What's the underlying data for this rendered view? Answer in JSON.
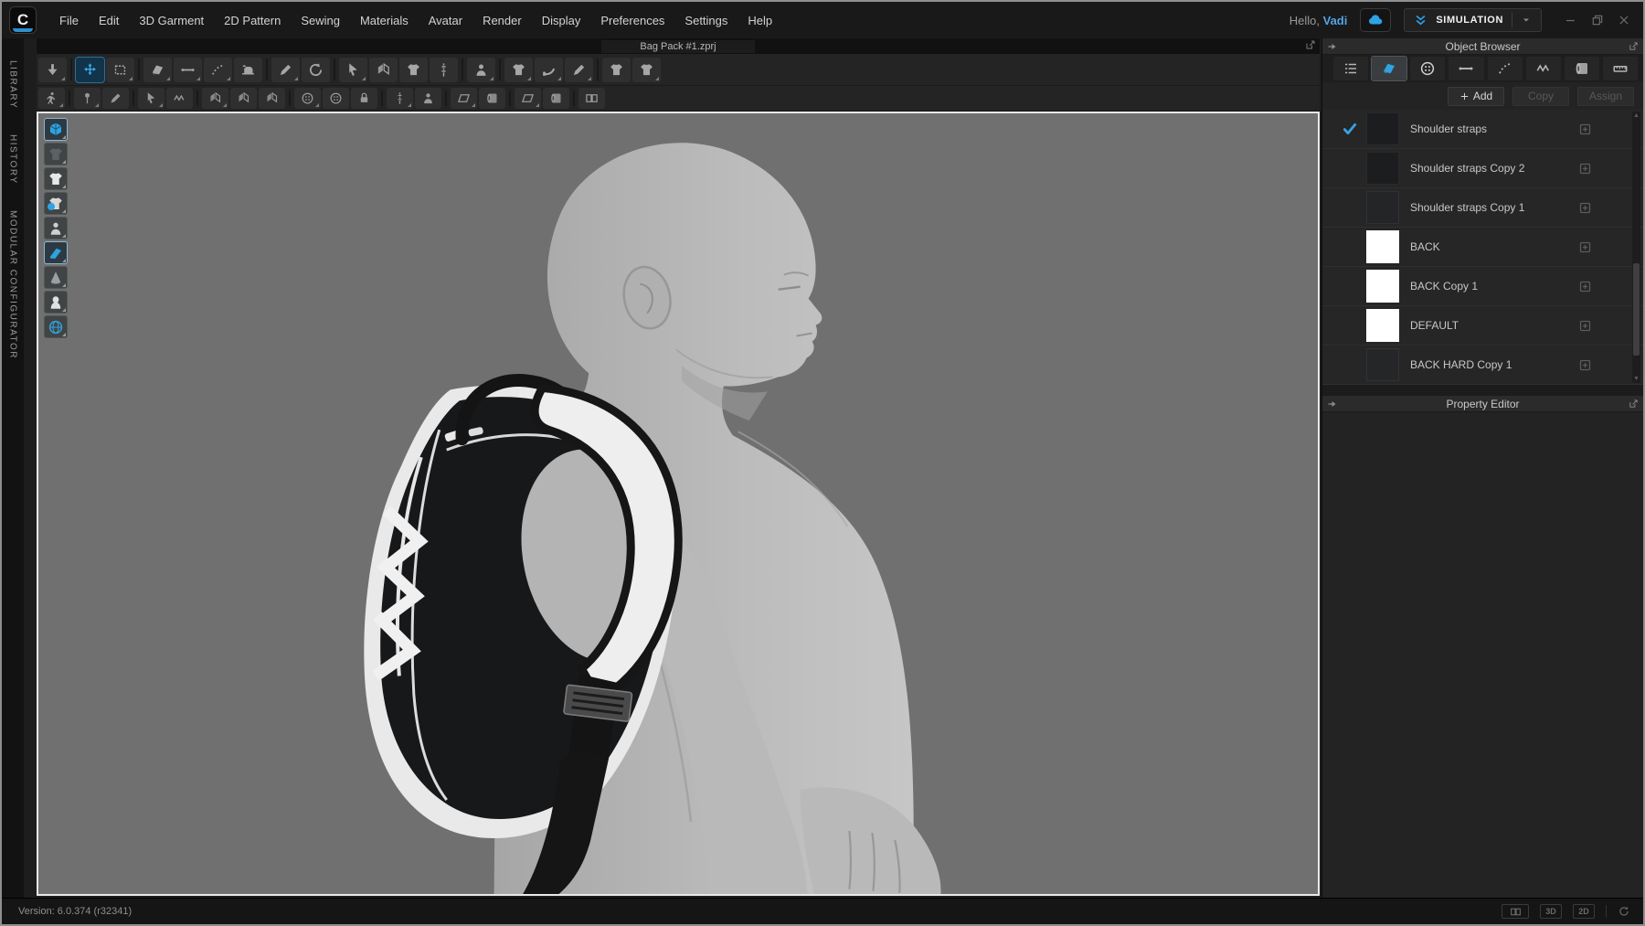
{
  "menubar": {
    "logo": "C",
    "items": [
      "File",
      "Edit",
      "3D Garment",
      "2D Pattern",
      "Sewing",
      "Materials",
      "Avatar",
      "Render",
      "Display",
      "Preferences",
      "Settings",
      "Help"
    ],
    "greeting_prefix": "Hello,",
    "greeting_name": "Vadi",
    "cloud_icon": "clo-cloud-icon",
    "mode_label": "SIMULATION",
    "window_controls": [
      "minimize",
      "restore",
      "close"
    ]
  },
  "document_tab": {
    "title": "Bag Pack #1.zprj"
  },
  "left_rail": {
    "tabs": [
      "LIBRARY",
      "HISTORY",
      "MODULAR CONFIGURATOR"
    ]
  },
  "toolbar_row1": {
    "icons": [
      "simulate",
      "select-move",
      "select-box",
      "transform-pattern",
      "edit-pinpoint",
      "edit-curvature",
      "edit-sewing",
      "pin",
      "gizmo-rotate",
      "arrange-point",
      "fold-arrangement",
      "hanger",
      "zipper",
      "avatar-display",
      "fit-maps",
      "tape-measure",
      "stylus-pen",
      "flip-fold-left",
      "flip-fold-right"
    ],
    "active": "select-move"
  },
  "toolbar_row2": {
    "icons": [
      "avatar-walk",
      "pin-select",
      "pin-remove",
      "sewing-select",
      "sewing-edit",
      "fold-left",
      "fold-pair",
      "fold-wrinkle",
      "button-select",
      "button-add",
      "buttonhole",
      "zipper-install",
      "avatar-size",
      "arrange-plane",
      "arrange-curve",
      "arrange-plane-b",
      "arrange-curve-b",
      "align-tools"
    ]
  },
  "viewport_tools": [
    "show-3d-garment",
    "show-internal-lines",
    "show-garment-fit",
    "show-strain-map",
    "show-avatar",
    "show-pattern-outline",
    "show-arrangement-points",
    "show-avatar-silhouette",
    "show-environment"
  ],
  "object_browser": {
    "title": "Object Browser",
    "tabs": [
      "scene-list",
      "fabric",
      "button",
      "topstitch",
      "stitch",
      "puckering",
      "fabric-roll",
      "measure"
    ],
    "selected_tab": "fabric",
    "buttons": {
      "add": "Add",
      "copy": "Copy",
      "assign": "Assign"
    },
    "items": [
      {
        "name": "Shoulder straps",
        "swatch": "#1b1d1f",
        "checked": true
      },
      {
        "name": "Shoulder straps Copy 2",
        "swatch": "#1b1d1f",
        "checked": false
      },
      {
        "name": "Shoulder straps Copy 1",
        "swatch": "#232527",
        "checked": false
      },
      {
        "name": "BACK",
        "swatch": "#ffffff",
        "checked": false
      },
      {
        "name": "BACK Copy 1",
        "swatch": "#ffffff",
        "checked": false
      },
      {
        "name": "DEFAULT",
        "swatch": "#ffffff",
        "checked": false
      },
      {
        "name": "BACK HARD Copy 1",
        "swatch": "#242628",
        "checked": false
      }
    ]
  },
  "property_editor": {
    "title": "Property Editor"
  },
  "statusbar": {
    "version": "Version: 6.0.374 (r32341)",
    "view_3d": "3D",
    "view_2d": "2D"
  },
  "scene": {
    "content": "male avatar profile facing right wearing black and white backpack on shoulder",
    "viewport_bg": "#707070",
    "avatar_color": "#b6b6b6",
    "backpack_black": "#17181a",
    "backpack_white": "#ececec"
  },
  "colors": {
    "accent_blue": "#2fa2e6",
    "check_blue": "#35a3e8",
    "name_blue": "#53a4e4"
  }
}
